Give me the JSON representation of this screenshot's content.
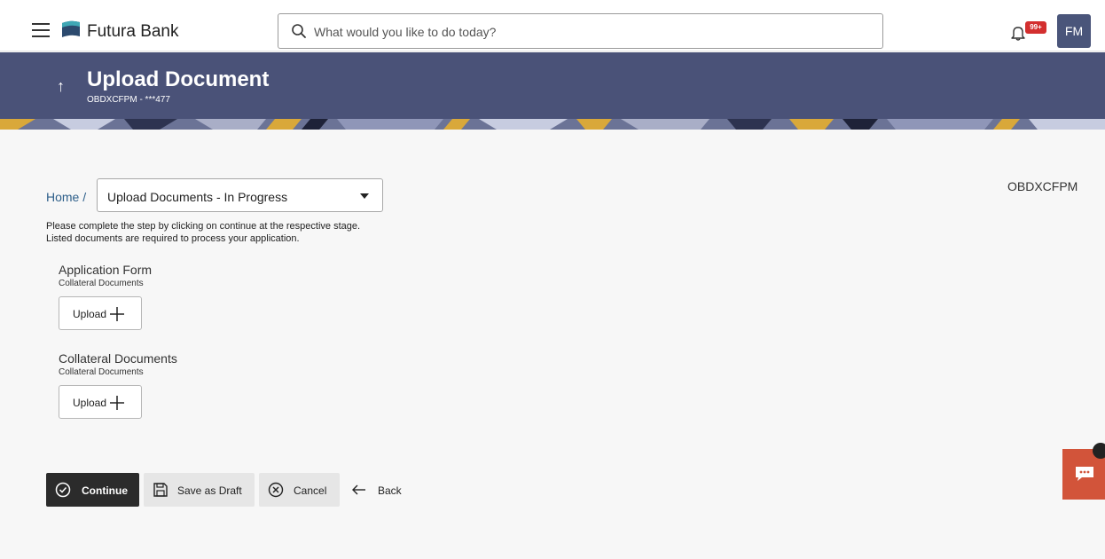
{
  "topbar": {
    "brand": "Futura Bank",
    "search_placeholder": "What would you like to do today?",
    "notification_badge": "99+",
    "avatar_initials": "FM"
  },
  "header": {
    "title": "Upload Document",
    "subtitle": "OBDXCFPM - ***477"
  },
  "breadcrumb": {
    "home": "Home /",
    "selected_option": "Upload Documents - In Progress"
  },
  "user_code": "OBDXCFPM",
  "instructions": [
    "Please complete the step by clicking on continue at the respective stage.",
    "Listed documents are required to process your application."
  ],
  "documents": [
    {
      "title": "Application Form",
      "subtitle": "Collateral Documents",
      "upload_label": "Upload"
    },
    {
      "title": "Collateral Documents",
      "subtitle": "Collateral Documents",
      "upload_label": "Upload"
    }
  ],
  "actions": {
    "continue": "Continue",
    "save_draft": "Save as Draft",
    "cancel": "Cancel",
    "back": "Back"
  },
  "colors": {
    "header_bg": "#4a5278",
    "avatar_bg": "#4a557a",
    "continue_bg": "#2b2b2b",
    "chat_bg": "#d2543a",
    "badge_bg": "#d32f2f",
    "link": "#2e5f8a"
  },
  "icons": [
    "hamburger-icon",
    "bank-logo-icon",
    "search-icon",
    "bell-icon",
    "up-arrow-icon",
    "caret-down-icon",
    "plus-icon",
    "check-circle-icon",
    "save-icon",
    "cancel-circle-icon",
    "arrow-left-icon",
    "chat-icon"
  ]
}
